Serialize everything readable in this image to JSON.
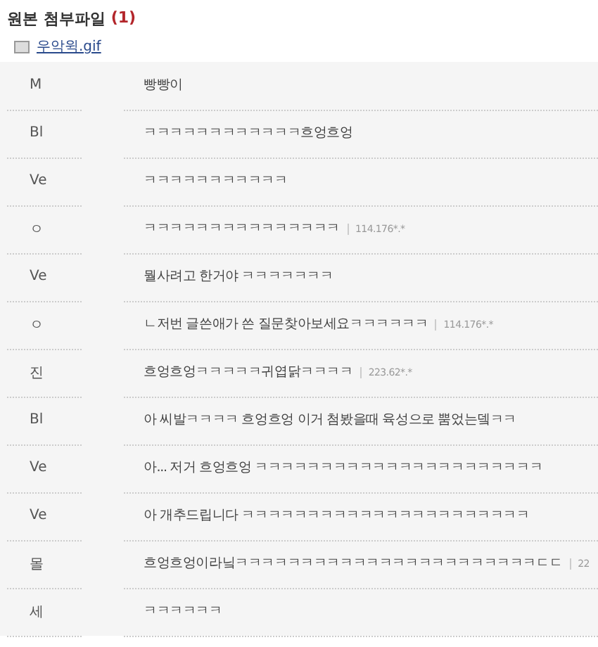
{
  "attachments": {
    "title": "원본 첨부파일",
    "count": "(1)",
    "files": [
      "우악윅.gif"
    ]
  },
  "comments": [
    {
      "author": "M",
      "text": "빵빵이"
    },
    {
      "author": "Bl",
      "text": "ㅋㅋㅋㅋㅋㅋㅋㅋㅋㅋㅋㅋ흐엉흐엉"
    },
    {
      "author": "Ve",
      "text": "ㅋㅋㅋㅋㅋㅋㅋㅋㅋㅋㅋ"
    },
    {
      "author": "ㅇ",
      "text": "ㅋㅋㅋㅋㅋㅋㅋㅋㅋㅋㅋㅋㅋㅋㅋ",
      "ip": "114.176*.*"
    },
    {
      "author": "Ve",
      "text": "뭘사려고 한거야 ㅋㅋㅋㅋㅋㅋㅋ"
    },
    {
      "author": "ㅇ",
      "text": "ㄴ저번 글쓴애가 쓴 질문찾아보세요ㅋㅋㅋㅋㅋㅋ",
      "ip": "114.176*.*"
    },
    {
      "author": "진",
      "text": "흐엉흐엉ㅋㅋㅋㅋㅋ귀엽닭ㅋㅋㅋㅋ",
      "ip": "223.62*.*"
    },
    {
      "author": "Bl",
      "text": "아 씨발ㅋㅋㅋㅋ 흐엉흐엉 이거 첨봤을때 육성으로 뿜었는뎈ㅋㅋ"
    },
    {
      "author": "Ve",
      "text": "아... 저거 흐엉흐엉 ㅋㅋㅋㅋㅋㅋㅋㅋㅋㅋㅋㅋㅋㅋㅋㅋㅋㅋㅋㅋㅋㅋ"
    },
    {
      "author": "Ve",
      "text": "아 개추드립니다 ㅋㅋㅋㅋㅋㅋㅋㅋㅋㅋㅋㅋㅋㅋㅋㅋㅋㅋㅋㅋㅋㅋ"
    },
    {
      "author": "몰",
      "text": "흐엉흐엉이라닠ㅋㅋㅋㅋㅋㅋㅋㅋㅋㅋㅋㅋㅋㅋㅋㅋㅋㅋㅋㅋㅋㅋㅋㄷㄷ",
      "ip": "22"
    },
    {
      "author": "세",
      "text": "ㅋㅋㅋㅋㅋㅋ"
    }
  ]
}
